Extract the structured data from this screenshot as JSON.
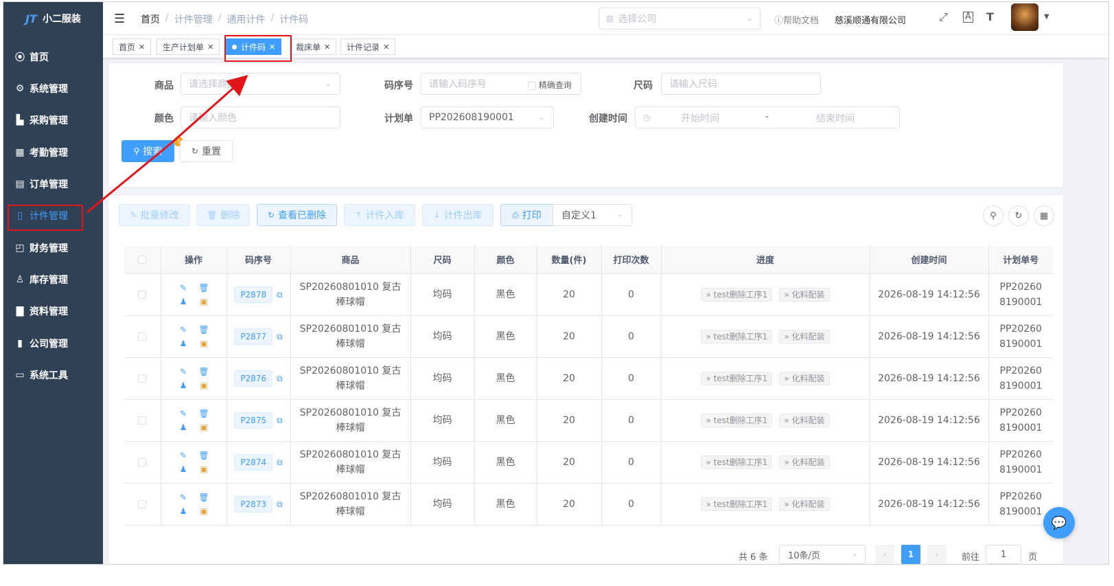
{
  "app": {
    "logo_mark": "JT",
    "title": "小二服装"
  },
  "sidebar": {
    "items": [
      {
        "label": "首页",
        "icon": "dashboard-icon",
        "glyph": "⦿"
      },
      {
        "label": "系统管理",
        "icon": "gear-icon",
        "glyph": "⚙"
      },
      {
        "label": "采购管理",
        "icon": "cart-icon",
        "glyph": "▙"
      },
      {
        "label": "考勤管理",
        "icon": "grid-icon",
        "glyph": "▦"
      },
      {
        "label": "订单管理",
        "icon": "order-icon",
        "glyph": "▤"
      },
      {
        "label": "计件管理",
        "icon": "book-icon",
        "glyph": "▯"
      },
      {
        "label": "财务管理",
        "icon": "chart-icon",
        "glyph": "◰"
      },
      {
        "label": "库存管理",
        "icon": "user-icon",
        "glyph": "♙"
      },
      {
        "label": "资料管理",
        "icon": "document-icon",
        "glyph": "▇"
      },
      {
        "label": "公司管理",
        "icon": "bar-chart-icon",
        "glyph": "▮"
      },
      {
        "label": "系统工具",
        "icon": "toolbox-icon",
        "glyph": "▭"
      }
    ]
  },
  "navbar": {
    "breadcrumb": [
      "首页",
      "计件管理",
      "通用计件",
      "计件码"
    ],
    "company_placeholder": "选择公司",
    "help": "帮助文档",
    "company_name": "慈溪顺通有限公司"
  },
  "tags": [
    {
      "label": "首页"
    },
    {
      "label": "生产计划单"
    },
    {
      "label": "计件码"
    },
    {
      "label": "裁床单"
    },
    {
      "label": "计件记录"
    }
  ],
  "search": {
    "product_label": "商品",
    "product_placeholder": "请选择商品",
    "code_label": "码序号",
    "code_placeholder": "请输入码序号",
    "exact_label": "精确查询",
    "size_label": "尺码",
    "size_placeholder": "请输入尺码",
    "color_label": "颜色",
    "color_placeholder": "请输入颜色",
    "plan_label": "计划单",
    "plan_value": "PP202608190001",
    "time_label": "创建时间",
    "time_start": "开始时间",
    "time_sep": "-",
    "time_end": "结束时间",
    "search_btn": "搜索",
    "reset_btn": "重置"
  },
  "toolbar": {
    "batch_edit": "批量修改",
    "delete": "删除",
    "view_deleted": "查看已删除",
    "stock_in": "计件入库",
    "stock_out": "计件出库",
    "print": "打印",
    "custom": "自定义1"
  },
  "table": {
    "headers": [
      "操作",
      "码序号",
      "商品",
      "尺码",
      "颜色",
      "数量(件)",
      "打印次数",
      "进度",
      "创建时间",
      "计划单号"
    ],
    "rows": [
      {
        "code": "P2878",
        "product": "SP20260801010 复古棒球帽",
        "size": "均码",
        "color": "黑色",
        "qty": "20",
        "prints": "0",
        "prog1": "test删除工序1",
        "prog2": "化料配装",
        "created": "2026-08-19 14:12:56",
        "plan": "PP202608190001"
      },
      {
        "code": "P2877",
        "product": "SP20260801010 复古棒球帽",
        "size": "均码",
        "color": "黑色",
        "qty": "20",
        "prints": "0",
        "prog1": "test删除工序1",
        "prog2": "化料配装",
        "created": "2026-08-19 14:12:56",
        "plan": "PP202608190001"
      },
      {
        "code": "P2876",
        "product": "SP20260801010 复古棒球帽",
        "size": "均码",
        "color": "黑色",
        "qty": "20",
        "prints": "0",
        "prog1": "test删除工序1",
        "prog2": "化料配装",
        "created": "2026-08-19 14:12:56",
        "plan": "PP202608190001"
      },
      {
        "code": "P2875",
        "product": "SP20260801010 复古棒球帽",
        "size": "均码",
        "color": "黑色",
        "qty": "20",
        "prints": "0",
        "prog1": "test删除工序1",
        "prog2": "化料配装",
        "created": "2026-08-19 14:12:56",
        "plan": "PP202608190001"
      },
      {
        "code": "P2874",
        "product": "SP20260801010 复古棒球帽",
        "size": "均码",
        "color": "黑色",
        "qty": "20",
        "prints": "0",
        "prog1": "test删除工序1",
        "prog2": "化料配装",
        "created": "2026-08-19 14:12:56",
        "plan": "PP202608190001"
      },
      {
        "code": "P2873",
        "product": "SP20260801010 复古棒球帽",
        "size": "均码",
        "color": "黑色",
        "qty": "20",
        "prints": "0",
        "prog1": "test删除工序1",
        "prog2": "化料配装",
        "created": "2026-08-19 14:12:56",
        "plan": "PP202608190001"
      }
    ]
  },
  "pagination": {
    "total": "共 6 条",
    "page_size": "10条/页",
    "current": "1",
    "goto_label": "前往",
    "goto_value": "1",
    "page_unit": "页"
  },
  "colors": {
    "primary": "#409eff",
    "sidebar": "#304156",
    "highlight": "#e0161b"
  }
}
